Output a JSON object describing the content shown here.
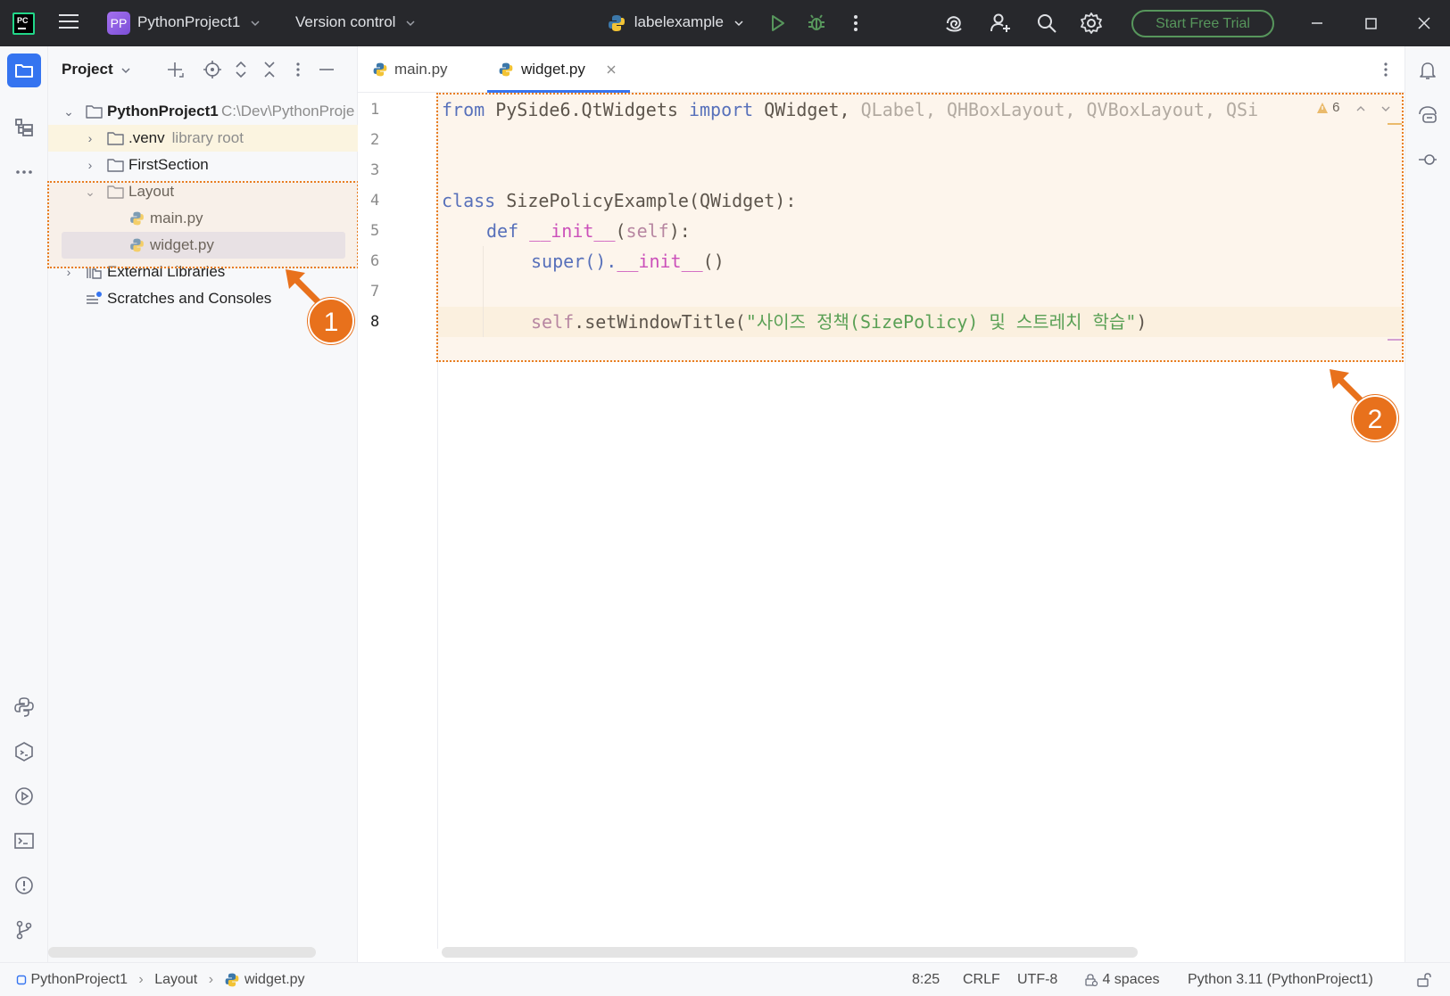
{
  "titlebar": {
    "logo_text": "PC",
    "project_badge": "PP",
    "project_name": "PythonProject1",
    "version_control": "Version control",
    "run_config": "labelexample",
    "trial_button": "Start Free Trial"
  },
  "project_panel": {
    "title": "Project",
    "tree": {
      "root_label": "PythonProject1",
      "root_path": "C:\\Dev\\PythonProje",
      "venv_label": ".venv",
      "venv_hint": "library root",
      "first_section": "FirstSection",
      "layout": "Layout",
      "main_py": "main.py",
      "widget_py": "widget.py",
      "external_libraries": "External Libraries",
      "scratches": "Scratches and Consoles"
    }
  },
  "editor": {
    "tabs": [
      {
        "label": "main.py",
        "active": false
      },
      {
        "label": "widget.py",
        "active": true
      }
    ],
    "line_numbers": [
      "1",
      "2",
      "3",
      "4",
      "5",
      "6",
      "7",
      "8"
    ],
    "current_line": 8,
    "warning_count": "6",
    "code": {
      "l1_from": "from",
      "l1_module": " PySide6.QtWidgets ",
      "l1_import": "import",
      "l1_qwidget": " QWidget, ",
      "l1_rest": "QLabel, QHBoxLayout, QVBoxLayout, QSi",
      "l4_class": "class",
      "l4_rest": " SizePolicyExample(QWidget):",
      "l5_def": "def",
      "l5_init": "__init__",
      "l5_open": "(",
      "l5_self": "self",
      "l5_close": "):",
      "l6_super": "super().",
      "l6_init": "__init__",
      "l6_close": "()",
      "l8_self": "self",
      "l8_method": ".setWindowTitle(",
      "l8_str": "\"사이즈 정책(SizePolicy) 및 스트레치 학습\"",
      "l8_close": ")"
    }
  },
  "annotations": {
    "badge_1": "1",
    "badge_2": "2",
    "accent_color": "#e8711c"
  },
  "statusbar": {
    "crumb_project": "PythonProject1",
    "crumb_folder": "Layout",
    "crumb_file": "widget.py",
    "position": "8:25",
    "line_sep": "CRLF",
    "encoding": "UTF-8",
    "indent": "4 spaces",
    "interpreter": "Python 3.11 (PythonProject1)"
  },
  "colors": {
    "accent_blue": "#3574f0",
    "trial_green": "#57965c",
    "titlebar_bg": "#27282c"
  }
}
